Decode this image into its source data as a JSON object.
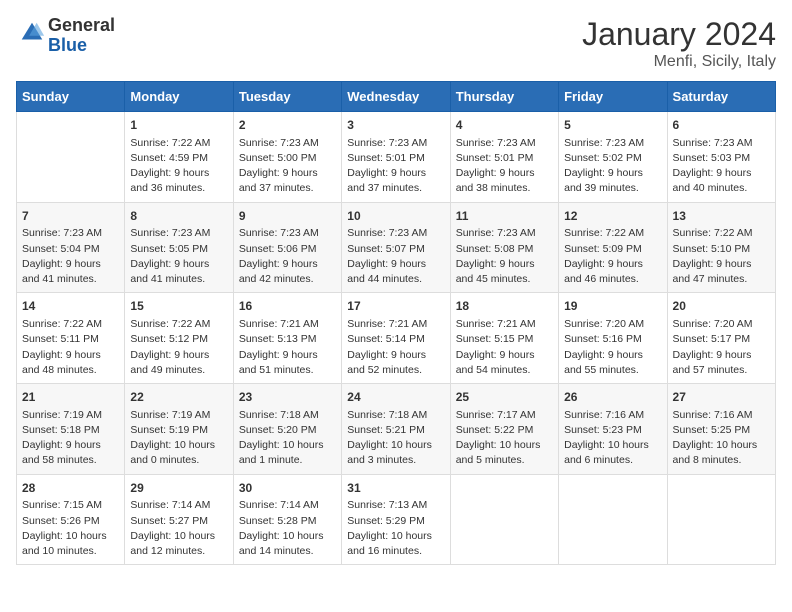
{
  "logo": {
    "general": "General",
    "blue": "Blue"
  },
  "title": "January 2024",
  "subtitle": "Menfi, Sicily, Italy",
  "days_of_week": [
    "Sunday",
    "Monday",
    "Tuesday",
    "Wednesday",
    "Thursday",
    "Friday",
    "Saturday"
  ],
  "weeks": [
    [
      {
        "day": "",
        "detail": ""
      },
      {
        "day": "1",
        "detail": "Sunrise: 7:22 AM\nSunset: 4:59 PM\nDaylight: 9 hours\nand 36 minutes."
      },
      {
        "day": "2",
        "detail": "Sunrise: 7:23 AM\nSunset: 5:00 PM\nDaylight: 9 hours\nand 37 minutes."
      },
      {
        "day": "3",
        "detail": "Sunrise: 7:23 AM\nSunset: 5:01 PM\nDaylight: 9 hours\nand 37 minutes."
      },
      {
        "day": "4",
        "detail": "Sunrise: 7:23 AM\nSunset: 5:01 PM\nDaylight: 9 hours\nand 38 minutes."
      },
      {
        "day": "5",
        "detail": "Sunrise: 7:23 AM\nSunset: 5:02 PM\nDaylight: 9 hours\nand 39 minutes."
      },
      {
        "day": "6",
        "detail": "Sunrise: 7:23 AM\nSunset: 5:03 PM\nDaylight: 9 hours\nand 40 minutes."
      }
    ],
    [
      {
        "day": "7",
        "detail": "Sunrise: 7:23 AM\nSunset: 5:04 PM\nDaylight: 9 hours\nand 41 minutes."
      },
      {
        "day": "8",
        "detail": "Sunrise: 7:23 AM\nSunset: 5:05 PM\nDaylight: 9 hours\nand 41 minutes."
      },
      {
        "day": "9",
        "detail": "Sunrise: 7:23 AM\nSunset: 5:06 PM\nDaylight: 9 hours\nand 42 minutes."
      },
      {
        "day": "10",
        "detail": "Sunrise: 7:23 AM\nSunset: 5:07 PM\nDaylight: 9 hours\nand 44 minutes."
      },
      {
        "day": "11",
        "detail": "Sunrise: 7:23 AM\nSunset: 5:08 PM\nDaylight: 9 hours\nand 45 minutes."
      },
      {
        "day": "12",
        "detail": "Sunrise: 7:22 AM\nSunset: 5:09 PM\nDaylight: 9 hours\nand 46 minutes."
      },
      {
        "day": "13",
        "detail": "Sunrise: 7:22 AM\nSunset: 5:10 PM\nDaylight: 9 hours\nand 47 minutes."
      }
    ],
    [
      {
        "day": "14",
        "detail": "Sunrise: 7:22 AM\nSunset: 5:11 PM\nDaylight: 9 hours\nand 48 minutes."
      },
      {
        "day": "15",
        "detail": "Sunrise: 7:22 AM\nSunset: 5:12 PM\nDaylight: 9 hours\nand 49 minutes."
      },
      {
        "day": "16",
        "detail": "Sunrise: 7:21 AM\nSunset: 5:13 PM\nDaylight: 9 hours\nand 51 minutes."
      },
      {
        "day": "17",
        "detail": "Sunrise: 7:21 AM\nSunset: 5:14 PM\nDaylight: 9 hours\nand 52 minutes."
      },
      {
        "day": "18",
        "detail": "Sunrise: 7:21 AM\nSunset: 5:15 PM\nDaylight: 9 hours\nand 54 minutes."
      },
      {
        "day": "19",
        "detail": "Sunrise: 7:20 AM\nSunset: 5:16 PM\nDaylight: 9 hours\nand 55 minutes."
      },
      {
        "day": "20",
        "detail": "Sunrise: 7:20 AM\nSunset: 5:17 PM\nDaylight: 9 hours\nand 57 minutes."
      }
    ],
    [
      {
        "day": "21",
        "detail": "Sunrise: 7:19 AM\nSunset: 5:18 PM\nDaylight: 9 hours\nand 58 minutes."
      },
      {
        "day": "22",
        "detail": "Sunrise: 7:19 AM\nSunset: 5:19 PM\nDaylight: 10 hours\nand 0 minutes."
      },
      {
        "day": "23",
        "detail": "Sunrise: 7:18 AM\nSunset: 5:20 PM\nDaylight: 10 hours\nand 1 minute."
      },
      {
        "day": "24",
        "detail": "Sunrise: 7:18 AM\nSunset: 5:21 PM\nDaylight: 10 hours\nand 3 minutes."
      },
      {
        "day": "25",
        "detail": "Sunrise: 7:17 AM\nSunset: 5:22 PM\nDaylight: 10 hours\nand 5 minutes."
      },
      {
        "day": "26",
        "detail": "Sunrise: 7:16 AM\nSunset: 5:23 PM\nDaylight: 10 hours\nand 6 minutes."
      },
      {
        "day": "27",
        "detail": "Sunrise: 7:16 AM\nSunset: 5:25 PM\nDaylight: 10 hours\nand 8 minutes."
      }
    ],
    [
      {
        "day": "28",
        "detail": "Sunrise: 7:15 AM\nSunset: 5:26 PM\nDaylight: 10 hours\nand 10 minutes."
      },
      {
        "day": "29",
        "detail": "Sunrise: 7:14 AM\nSunset: 5:27 PM\nDaylight: 10 hours\nand 12 minutes."
      },
      {
        "day": "30",
        "detail": "Sunrise: 7:14 AM\nSunset: 5:28 PM\nDaylight: 10 hours\nand 14 minutes."
      },
      {
        "day": "31",
        "detail": "Sunrise: 7:13 AM\nSunset: 5:29 PM\nDaylight: 10 hours\nand 16 minutes."
      },
      {
        "day": "",
        "detail": ""
      },
      {
        "day": "",
        "detail": ""
      },
      {
        "day": "",
        "detail": ""
      }
    ]
  ]
}
